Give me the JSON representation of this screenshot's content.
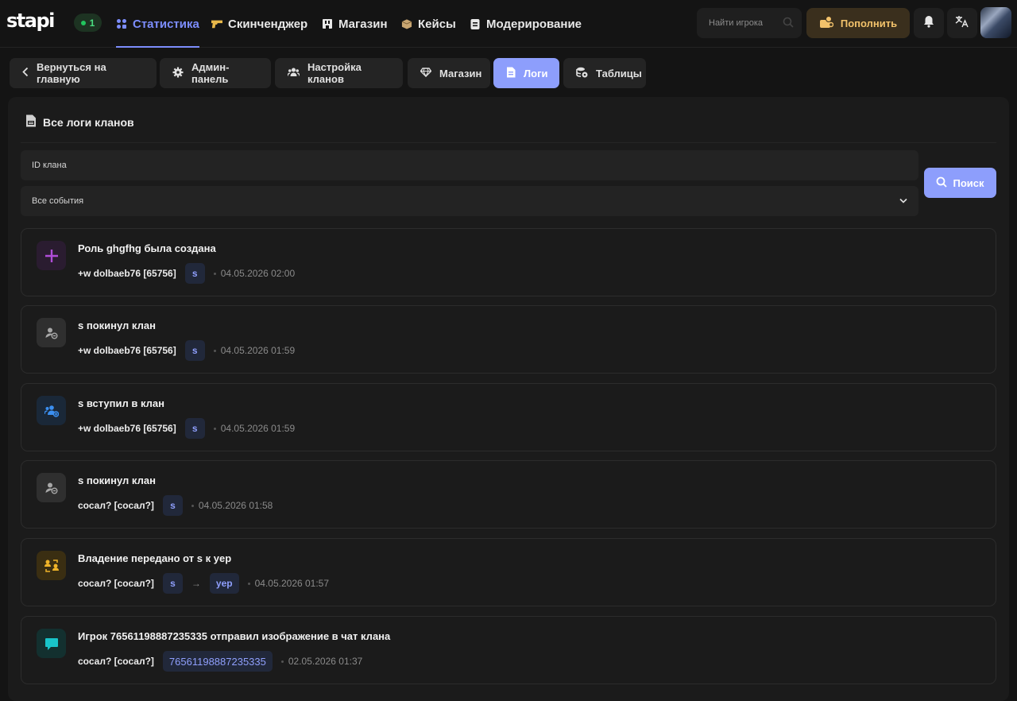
{
  "brand": {
    "logo": "stapi",
    "online_count": "1"
  },
  "nav": {
    "items": [
      {
        "label": "Статистика",
        "icon": "grid-dots-icon"
      },
      {
        "label": "Скинченджер",
        "icon": "gun-icon"
      },
      {
        "label": "Магазин",
        "icon": "shop-icon"
      },
      {
        "label": "Кейсы",
        "icon": "box-icon"
      },
      {
        "label": "Модерирование",
        "icon": "clipboard-icon"
      }
    ],
    "search_placeholder": "Найти игрока",
    "topup_label": "Пополнить"
  },
  "subtabs": [
    {
      "label": "Вернуться на главную",
      "icon": "chevron-left-icon"
    },
    {
      "label": "Админ-панель",
      "icon": "gear-icon"
    },
    {
      "label": "Настройка кланов",
      "icon": "users-icon"
    },
    {
      "label": "Магазин",
      "icon": "diamond-icon"
    },
    {
      "label": "Логи",
      "icon": "document-icon"
    },
    {
      "label": "Таблицы",
      "icon": "table-icon"
    }
  ],
  "panel": {
    "title": "Все логи кланов",
    "clan_id_placeholder": "ID клана",
    "events_select": "Все события",
    "search_button": "Поиск"
  },
  "logs": [
    {
      "title": "Роль ghgfhg была создана",
      "actor": "+w dolbaeb76 [65756]",
      "chips": [
        "s"
      ],
      "time": "04.05.2026 02:00",
      "icon": "plus-icon"
    },
    {
      "title": "s покинул клан",
      "actor": "+w dolbaeb76 [65756]",
      "chips": [
        "s"
      ],
      "time": "04.05.2026 01:59",
      "icon": "user-leave-icon"
    },
    {
      "title": "s вступил в клан",
      "actor": "+w dolbaeb76 [65756]",
      "chips": [
        "s"
      ],
      "time": "04.05.2026 01:59",
      "icon": "user-join-icon"
    },
    {
      "title": "s покинул клан",
      "actor": "сосал? [сосал?]",
      "chips": [
        "s"
      ],
      "time": "04.05.2026 01:58",
      "icon": "user-leave-icon"
    },
    {
      "title": "Владение передано от s к yep",
      "actor": "сосал? [сосал?]",
      "chips": [
        "s",
        "yep"
      ],
      "arrow": "→",
      "time": "04.05.2026 01:57",
      "icon": "transfer-icon"
    },
    {
      "title": "Игрок 76561198887235335 отправил изображение в чат клана",
      "actor": "сосал? [сосал?]",
      "chips": [
        "76561198887235335"
      ],
      "time": "02.05.2026 01:37",
      "icon": "chat-icon"
    }
  ]
}
